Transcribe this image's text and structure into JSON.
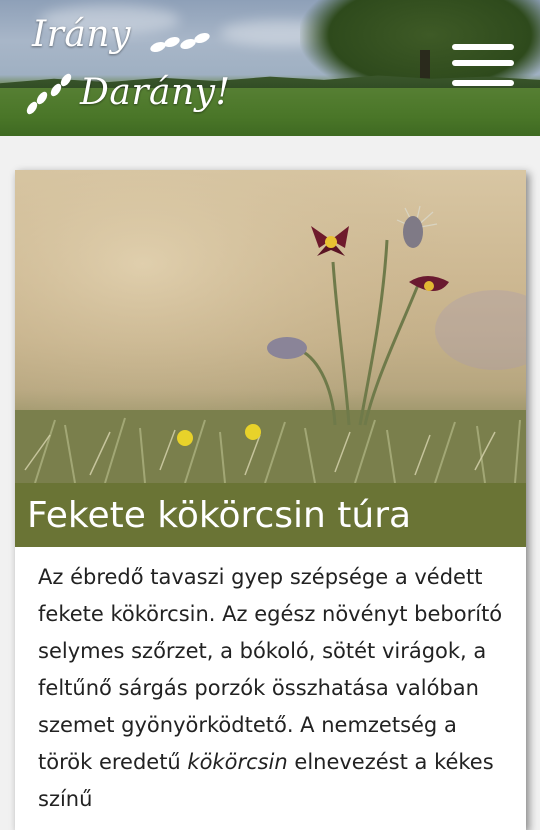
{
  "site": {
    "logo_line_1": "Irány",
    "logo_line_2": "Darány!",
    "logo_icon": "footprints-icon",
    "menu_icon": "hamburger-menu-icon"
  },
  "card": {
    "image_alt": "Fekete kökörcsin virágok",
    "title": "Fekete kökörcsin túra",
    "body_lead": "Az ébredő tavaszi gyep szépsége a védett fekete kökörcsin. Az egész növényt beborító selymes szőrzet, a bókoló, sötét virágok, a feltűnő sárgás porzók összhatása valóban szemet gyönyörködtető. A nemzetség a török eredetű ",
    "body_emphasis": "kökörcsin",
    "body_tail": " elnevezést a kékes színű"
  },
  "colors": {
    "title_bar": "#6a7435",
    "page_background": "#f1f1f1",
    "card_background": "#ffffff"
  }
}
